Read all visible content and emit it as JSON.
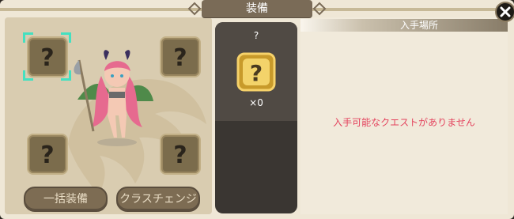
{
  "header": {
    "title": "装備"
  },
  "equipment_slots": [
    {
      "name": "slot-top-left",
      "state": "empty",
      "glyph": "?"
    },
    {
      "name": "slot-top-right",
      "state": "empty",
      "glyph": "?"
    },
    {
      "name": "slot-bottom-left",
      "state": "empty",
      "glyph": "?"
    },
    {
      "name": "slot-bottom-right",
      "state": "empty",
      "glyph": "?"
    }
  ],
  "buttons": {
    "bulk_equip": "一括装備",
    "class_change": "クラスチェンジ"
  },
  "item_detail": {
    "name": "?",
    "icon": "question-mark-item-icon",
    "count": "×0"
  },
  "source": {
    "title": "入手場所",
    "message": "入手可能なクエストがありません"
  },
  "colors": {
    "accent_teal": "#44e0c0",
    "warning_text": "#e4445e",
    "panel_dark": "#3a3632"
  }
}
